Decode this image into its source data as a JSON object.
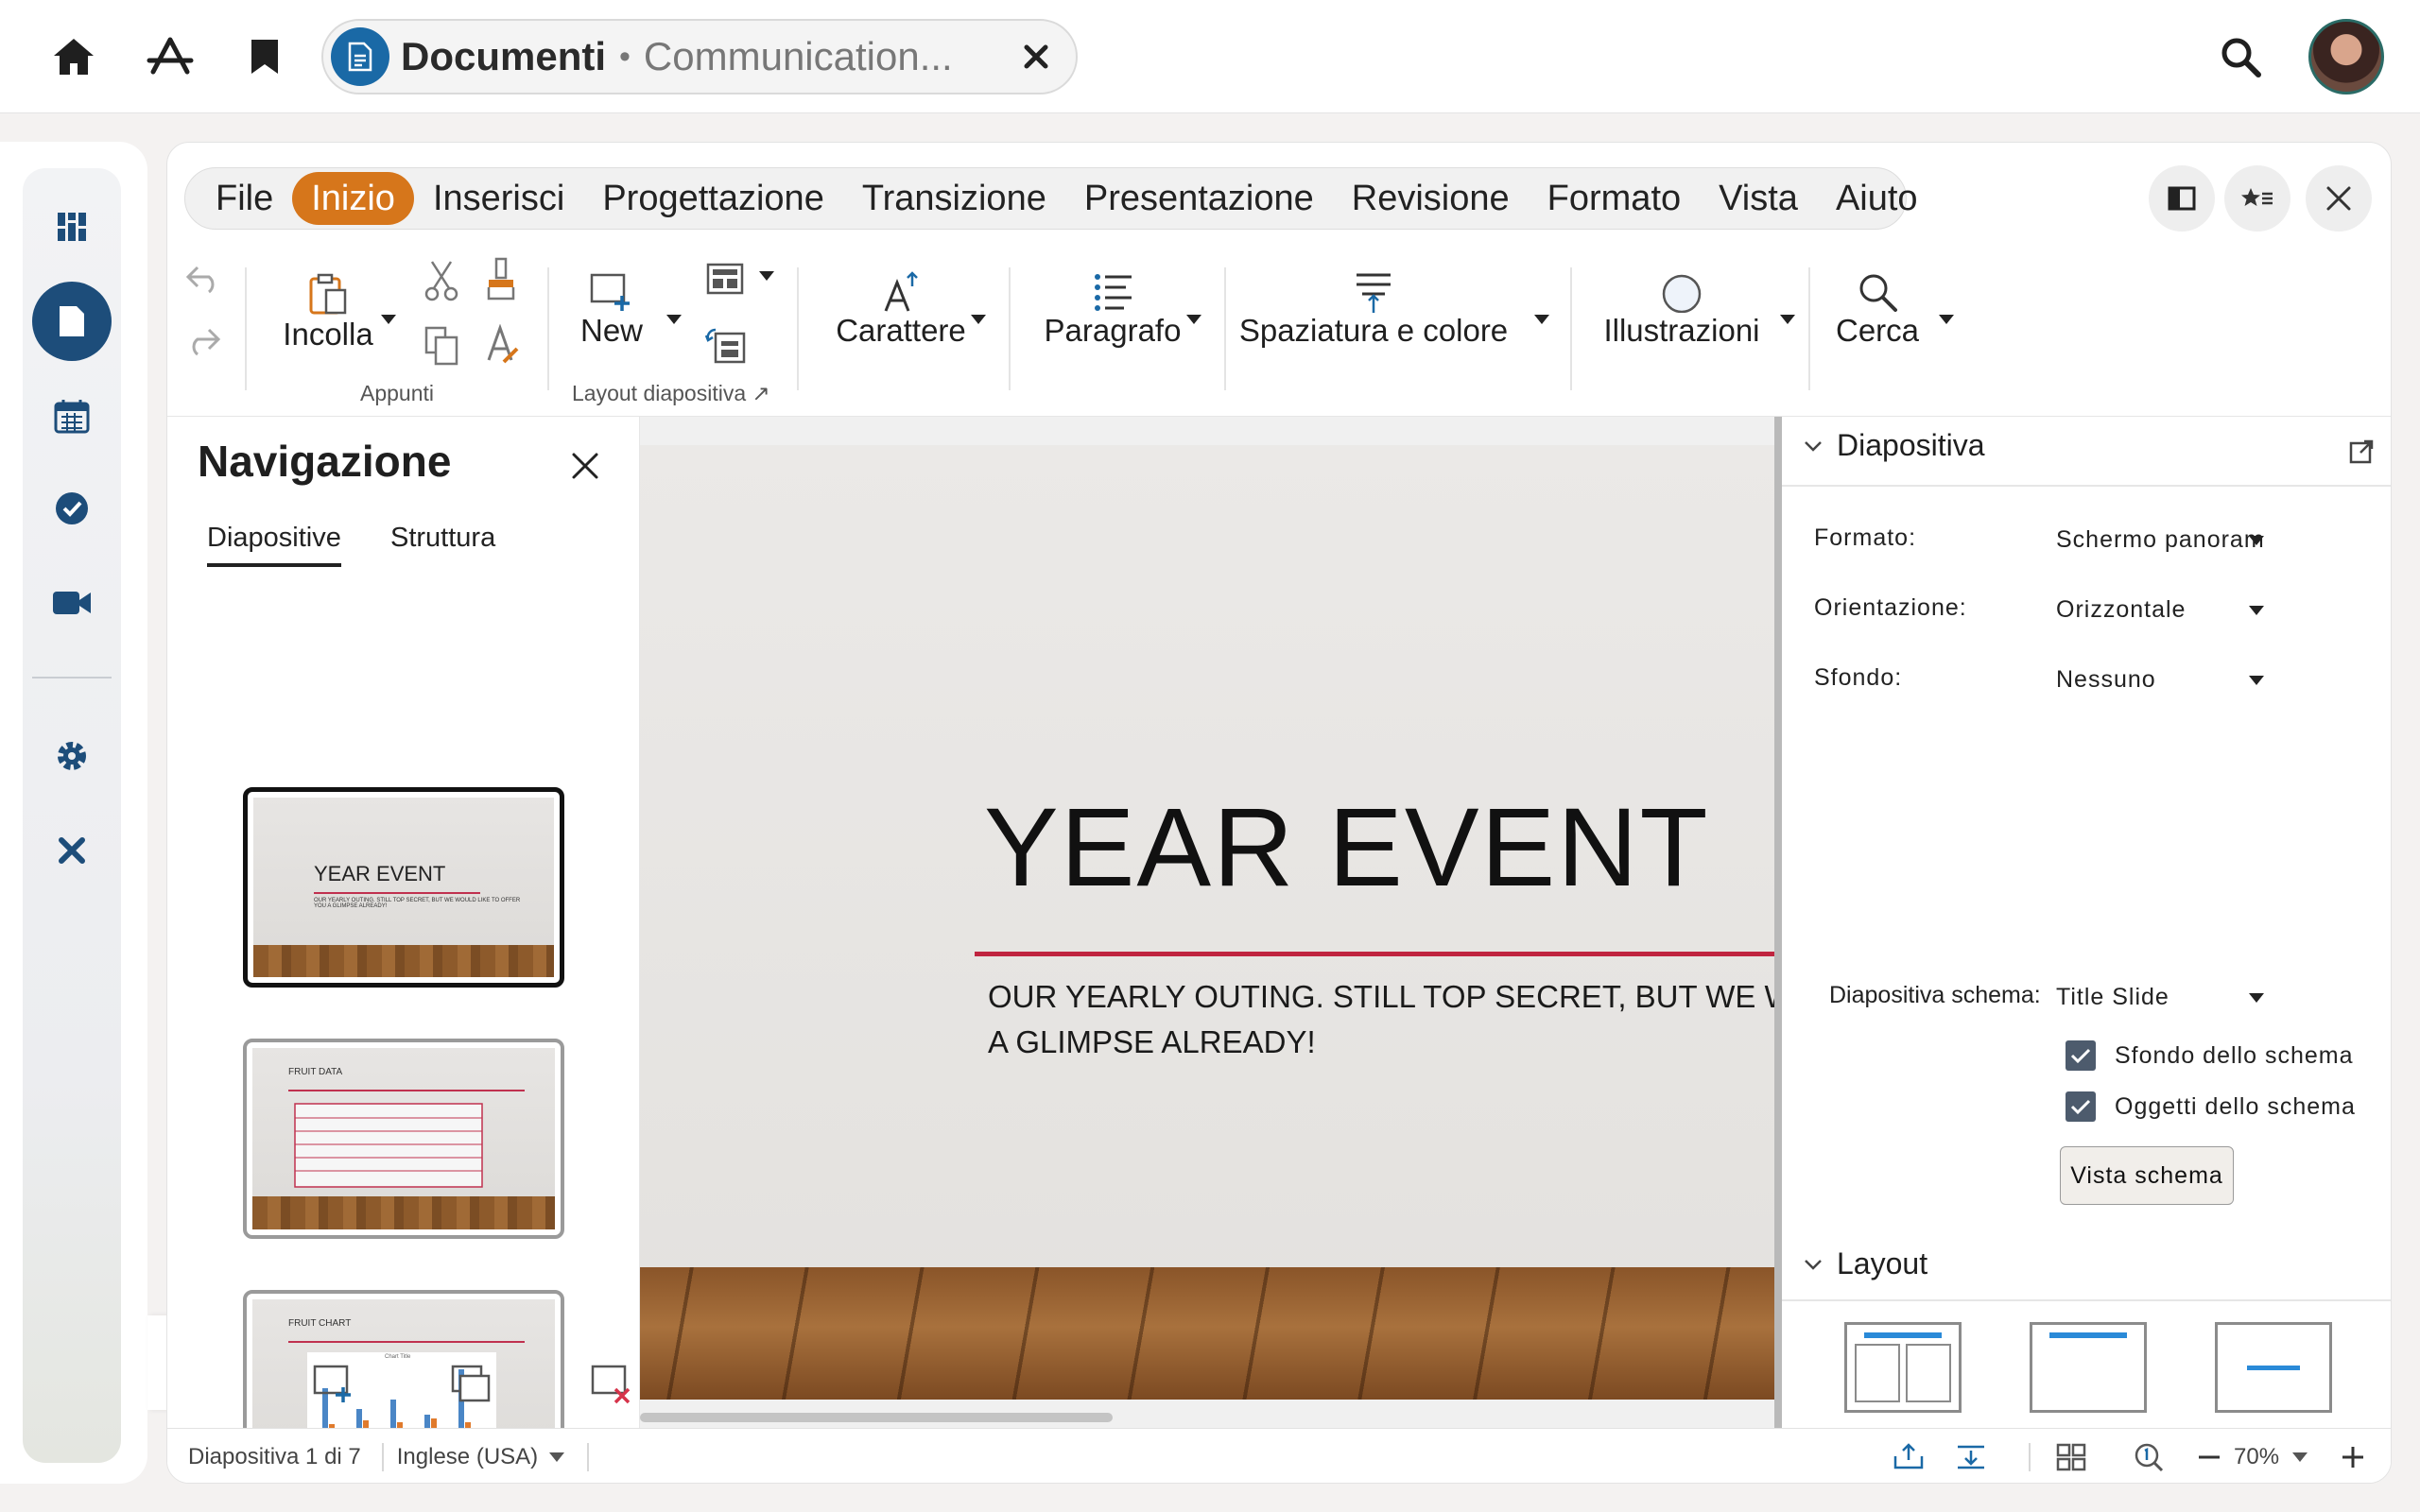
{
  "app": {
    "name": "Documenti",
    "document_name": "Communication..."
  },
  "menu": {
    "items": [
      "File",
      "Inizio",
      "Inserisci",
      "Progettazione",
      "Transizione",
      "Presentazione",
      "Revisione",
      "Formato",
      "Vista",
      "Aiuto"
    ],
    "active": "Inizio"
  },
  "ribbon": {
    "paste": "Incolla",
    "clipboard_group": "Appunti",
    "new_slide": "New",
    "layout_group": "Layout diapositiva",
    "character": "Carattere",
    "paragraph": "Paragrafo",
    "spacing": "Spaziatura e colore",
    "illustrations": "Illustrazioni",
    "find": "Cerca"
  },
  "navigator": {
    "title": "Navigazione",
    "tabs": [
      "Diapositive",
      "Struttura"
    ],
    "thumbs": [
      {
        "title": "YEAR EVENT",
        "subtitle": "OUR YEARLY OUTING. STILL TOP SECRET, BUT WE WOULD LIKE TO OFFER YOU A GLIMPSE ALREADY!"
      },
      {
        "title": "FRUIT DATA"
      },
      {
        "title": "FRUIT CHART",
        "chart_title": "Chart Title"
      }
    ]
  },
  "slide": {
    "title": "YEAR EVENT",
    "subtitle_line1": "OUR YEARLY OUTING. STILL TOP SECRET, BUT WE WOU",
    "subtitle_line2": "A GLIMPSE ALREADY!"
  },
  "sidebar": {
    "section_slide": "Diapositiva",
    "format_label": "Formato:",
    "format_value": "Schermo panoram",
    "orientation_label": "Orientazione:",
    "orientation_value": "Orizzontale",
    "background_label": "Sfondo:",
    "background_value": "Nessuno",
    "master_label": "Diapositiva schema:",
    "master_value": "Title Slide",
    "master_bg": "Sfondo dello schema",
    "master_objects": "Oggetti dello schema",
    "master_view_button": "Vista schema",
    "section_layout": "Layout"
  },
  "status": {
    "slide_count": "Diapositiva 1 di 7",
    "language": "Inglese (USA)",
    "zoom": "70%"
  },
  "colors": {
    "accent": "#d6761b",
    "brand": "#1a69a6",
    "rail_active": "#1d4d7a",
    "slide_rule": "#c0243f"
  }
}
